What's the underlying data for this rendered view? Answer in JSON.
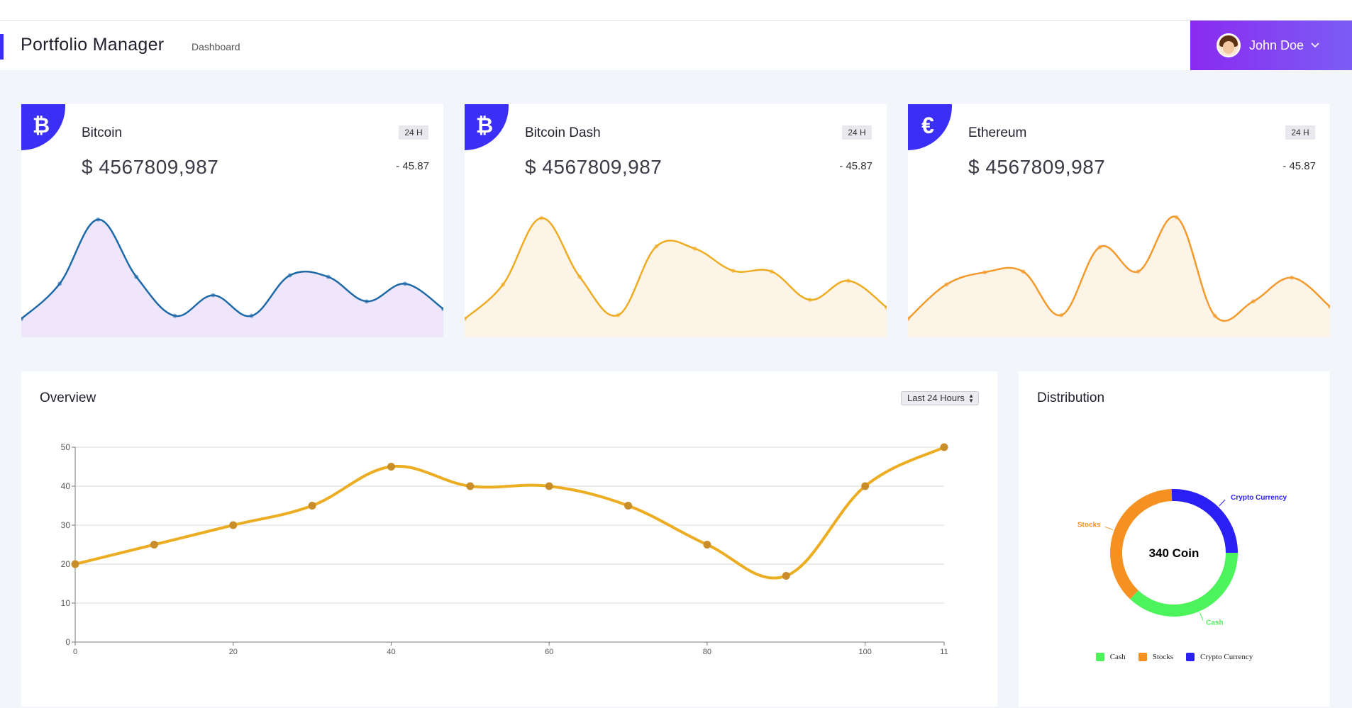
{
  "app": {
    "title": "Portfolio Manager",
    "breadcrumb": "Dashboard"
  },
  "user": {
    "name": "John Doe"
  },
  "coins": [
    {
      "name": "Bitcoin",
      "icon": "bitcoin-icon",
      "symbol": "₿",
      "price": "$ 4567809,987",
      "period": "24 H",
      "change": "- 45.87",
      "color": "#1d69a8",
      "fill": "#efe6fb",
      "series": [
        0,
        4.6,
        13,
        5.5,
        0.4,
        3.1,
        0.4,
        5.7,
        5.5,
        2.3,
        4.6,
        1.3
      ]
    },
    {
      "name": "Bitcoin Dash",
      "icon": "bitcoin-icon",
      "symbol": "₿",
      "price": "$ 4567809,987",
      "period": "24 H",
      "change": "- 45.87",
      "color": "#eeac22",
      "fill": "#fdf4e8",
      "series": [
        0,
        4.5,
        13.2,
        5.5,
        0.5,
        9.5,
        9.2,
        6.3,
        6.2,
        2.5,
        5,
        1.5
      ]
    },
    {
      "name": "Ethereum",
      "icon": "euro-icon",
      "symbol": "€",
      "price": "$ 4567809,987",
      "period": "24 H",
      "change": "- 45.87",
      "color": "#f39a2c",
      "fill": "#fdf4e8",
      "series": [
        0,
        4.5,
        6.1,
        6.2,
        0.5,
        9.4,
        6.2,
        13.3,
        0.4,
        2.3,
        5.4,
        1.6
      ]
    }
  ],
  "overview": {
    "title": "Overview",
    "range_label": "Last 24 Hours",
    "range_options": [
      "Last 24 Hours"
    ]
  },
  "distribution": {
    "title": "Distribution",
    "center_label": "340 Coin"
  },
  "chart_data": [
    {
      "type": "line",
      "title": "Overview",
      "x": [
        0,
        10,
        20,
        30,
        40,
        50,
        60,
        70,
        80,
        90,
        100,
        110
      ],
      "x_tick_labels": [
        "0",
        "20",
        "40",
        "60",
        "80",
        "100",
        "11"
      ],
      "y_ticks": [
        0,
        10,
        20,
        30,
        40,
        50
      ],
      "ylim": [
        0,
        50
      ],
      "xlim": [
        0,
        110
      ],
      "grid": true,
      "series": [
        {
          "values": [
            20,
            25,
            30,
            35,
            45,
            40,
            40,
            35,
            25,
            17,
            40,
            50
          ],
          "color": "#ecad22"
        }
      ]
    },
    {
      "type": "pie",
      "title": "Distribution",
      "categories": [
        "Cash",
        "Stocks",
        "Crypto Currency"
      ],
      "values": [
        126,
        127,
        87
      ],
      "colors": [
        "#4cf35a",
        "#f59120",
        "#2a1ff4"
      ],
      "legend": "bottom"
    }
  ]
}
